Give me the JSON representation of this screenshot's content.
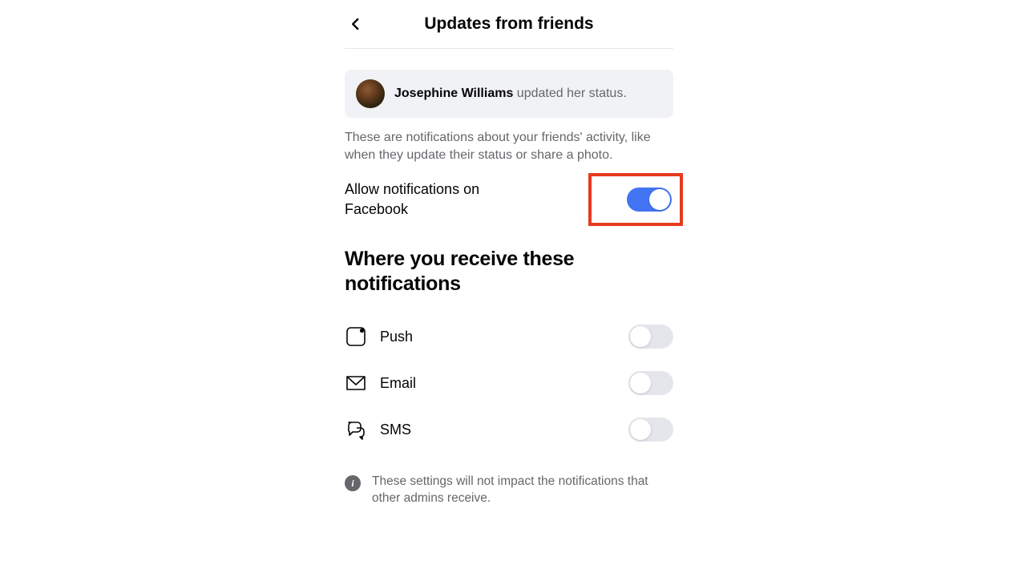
{
  "header": {
    "title": "Updates from friends"
  },
  "example": {
    "name": "Josephine Williams",
    "action": " updated her status."
  },
  "description": "These are notifications about your friends' activity, like when they update their status or share a photo.",
  "allow": {
    "label": "Allow notifications on Facebook",
    "on": true
  },
  "section_heading": "Where you receive these notifications",
  "channels": [
    {
      "id": "push",
      "label": "Push",
      "on": false
    },
    {
      "id": "email",
      "label": "Email",
      "on": false
    },
    {
      "id": "sms",
      "label": "SMS",
      "on": false
    }
  ],
  "note": "These settings will not impact the notifications that other admins receive."
}
